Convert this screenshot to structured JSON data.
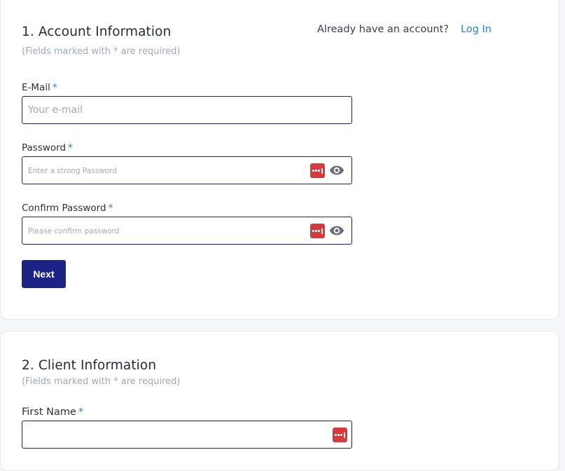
{
  "account_section": {
    "title": "1. Account Information",
    "subtitle": "(Fields marked with * are required)",
    "login_prompt": "Already have an account?",
    "login_link": "Log In",
    "fields": {
      "email": {
        "label": "E-Mail",
        "required_mark": "*",
        "value": "",
        "placeholder": "Your e-mail"
      },
      "password": {
        "label": "Password",
        "required_mark": "*",
        "value": "",
        "placeholder": "Enter a strong Password",
        "icons": [
          "password-manager-icon",
          "eye-icon"
        ]
      },
      "confirm_password": {
        "label": "Confirm Password",
        "required_mark": "*",
        "value": "",
        "placeholder": "Please confirm password",
        "icons": [
          "password-manager-icon",
          "eye-icon"
        ]
      }
    },
    "next_button": "Next"
  },
  "client_section": {
    "title": "2. Client Information",
    "subtitle": "(Fields marked with * are required)",
    "fields": {
      "first_name": {
        "label": "First Name",
        "required_mark": "*",
        "value": "",
        "placeholder": "",
        "icons": [
          "password-manager-icon"
        ]
      }
    }
  },
  "colors": {
    "primary_button": "#1c2387",
    "input_border": "#1f2266",
    "link": "#2f80d0",
    "required_mark": "#2f80d0",
    "password_manager": "#d8393f",
    "subtitle": "#a2a8ba"
  }
}
